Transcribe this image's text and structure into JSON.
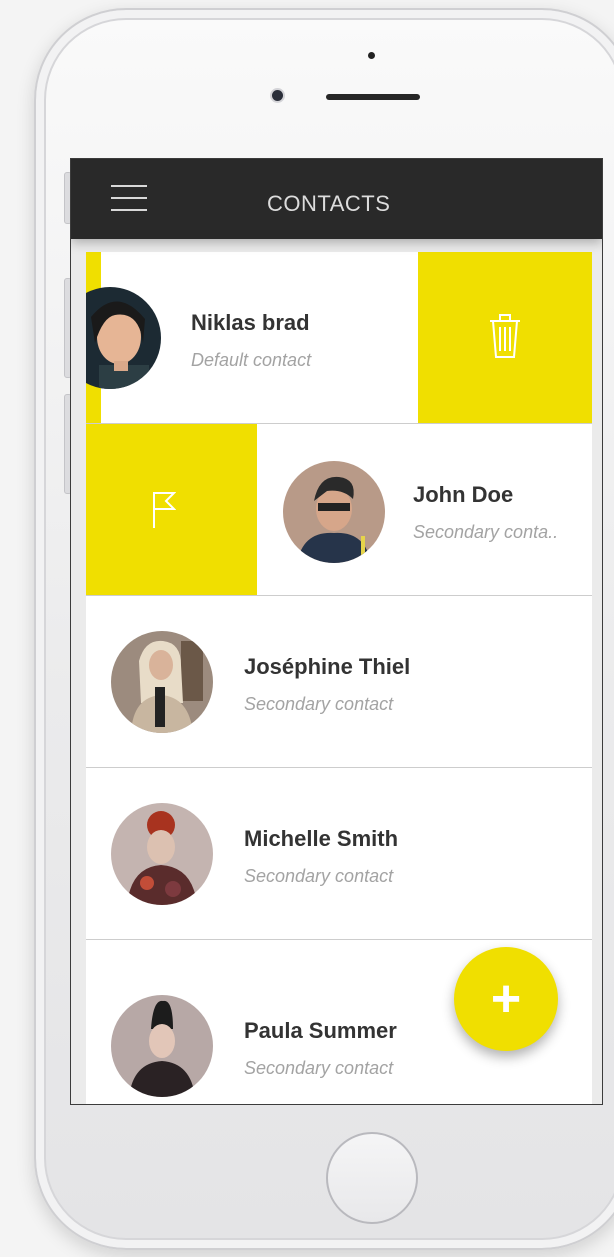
{
  "app": {
    "title": "CONTACTS"
  },
  "contacts": [
    {
      "name": "Niklas brad",
      "subtitle": "Default contact",
      "swipe_action": "delete",
      "action_icon": "trash-icon"
    },
    {
      "name": "John Doe",
      "subtitle": "Secondary conta..",
      "swipe_action": "flag",
      "action_icon": "flag-icon"
    },
    {
      "name": "Joséphine Thiel",
      "subtitle": "Secondary contact"
    },
    {
      "name": "Michelle Smith",
      "subtitle": "Secondary contact"
    },
    {
      "name": "Paula Summer",
      "subtitle": "Secondary contact"
    }
  ],
  "fab": {
    "label": "+",
    "icon": "plus-icon"
  },
  "colors": {
    "accent": "#f0df00",
    "appbar": "#292929"
  }
}
